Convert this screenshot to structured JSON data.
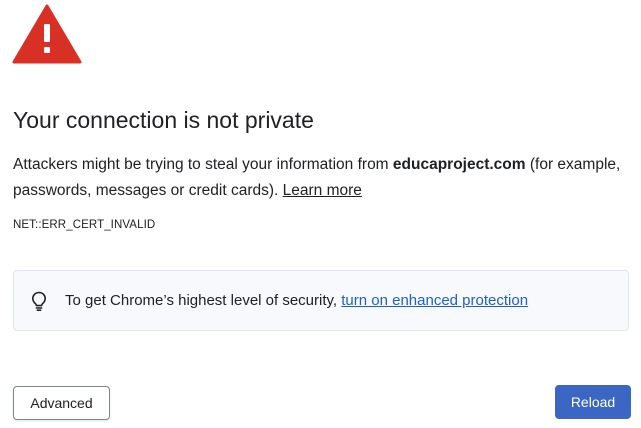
{
  "icon": {
    "name": "warning-triangle-icon",
    "color": "#d93025"
  },
  "title": "Your connection is not private",
  "message": {
    "before_host": "Attackers might be trying to steal your information from ",
    "host": "educaproject.com",
    "after_host": " (for example, passwords, messages or credit cards). ",
    "learn_more": "Learn more"
  },
  "error_code": "NET::ERR_CERT_INVALID",
  "security_tip": {
    "icon": "lightbulb-icon",
    "text": "To get Chrome’s highest level of security, ",
    "link": "turn on enhanced protection"
  },
  "buttons": {
    "advanced": "Advanced",
    "reload": "Reload"
  },
  "colors": {
    "accent": "#3b66c4",
    "link": "#1f5fc8",
    "danger": "#d93025"
  }
}
